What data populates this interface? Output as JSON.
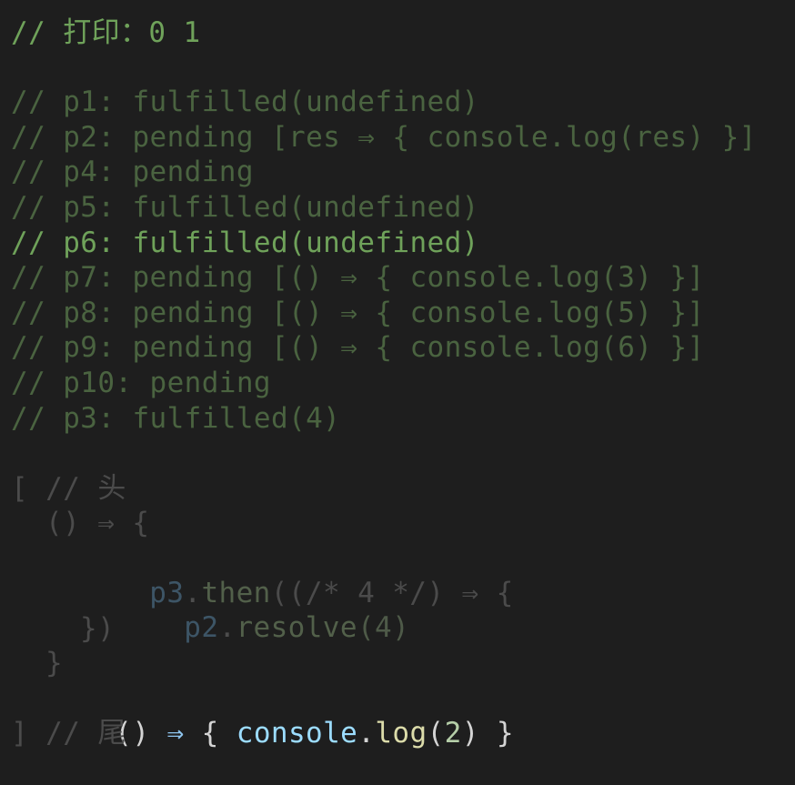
{
  "comments": {
    "print_line": "// 打印：0 1",
    "states": [
      "// p1: fulfilled(undefined)",
      "// p2: pending [res ⇒ { console.log(res) }]",
      "// p4: pending",
      "// p5: fulfilled(undefined)",
      "// p6: fulfilled(undefined)",
      "// p7: pending [() ⇒ { console.log(3) }]",
      "// p8: pending [() ⇒ { console.log(5) }]",
      "// p9: pending [() ⇒ { console.log(6) }]",
      "// p10: pending",
      "// p3: fulfilled(4)"
    ],
    "active_index": 4
  },
  "queue": {
    "open": "[ // 头",
    "fn1_open": "() ⇒ {",
    "then_var": "p3",
    "then_dot": ".",
    "then_fn": "then",
    "then_args": "((/* 4 */) ⇒ {",
    "resolve_var": "p2",
    "resolve_dot": ".",
    "resolve_fn": "resolve",
    "resolve_args": "(4)",
    "inner_close": "})",
    "fn1_close": "}",
    "fn2_paren": "()",
    "fn2_arrow": "⇒",
    "fn2_brace_open": "{",
    "fn2_console": "console",
    "fn2_dot": ".",
    "fn2_log": "log",
    "fn2_lparen": "(",
    "fn2_num": "2",
    "fn2_rparen": ")",
    "fn2_brace_close": "}",
    "close": "] // 尾"
  }
}
